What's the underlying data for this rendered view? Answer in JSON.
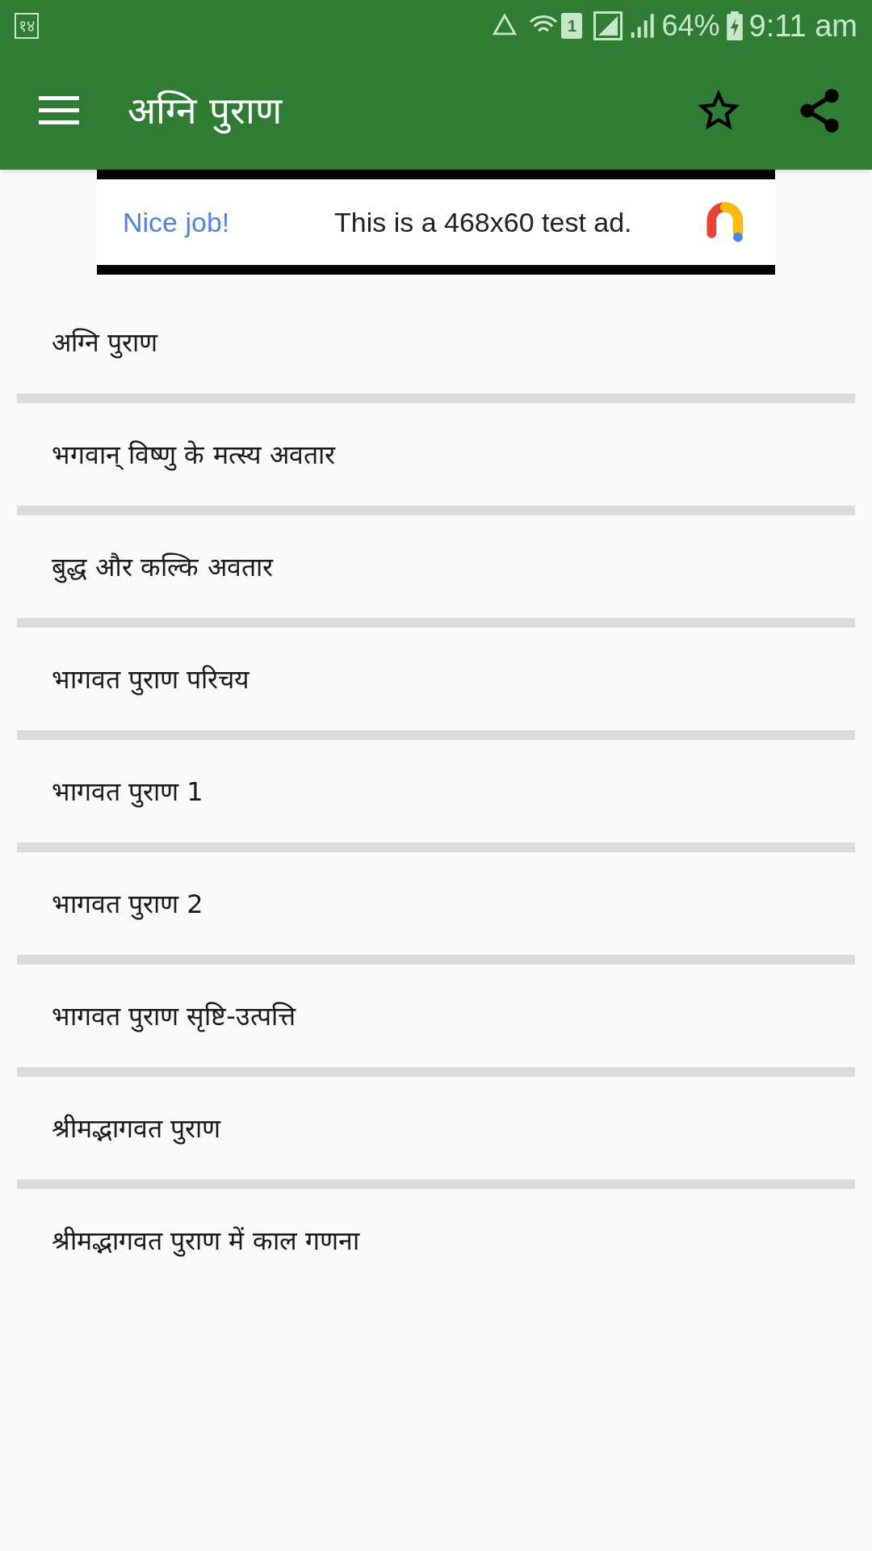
{
  "status_bar": {
    "notification": "१४",
    "battery": "64%",
    "time": "9:11 am",
    "sim": "1"
  },
  "toolbar": {
    "title": "अग्नि पुराण"
  },
  "ad": {
    "headline": "Nice job!",
    "text": "This is a 468x60 test ad."
  },
  "items": [
    {
      "label": "अग्नि पुराण"
    },
    {
      "label": "भगवान् विष्णु के मत्स्य अवतार"
    },
    {
      "label": "बुद्ध और कल्कि अवतार"
    },
    {
      "label": "भागवत पुराण परिचय"
    },
    {
      "label": "भागवत पुराण 1"
    },
    {
      "label": "भागवत पुराण 2"
    },
    {
      "label": "भागवत पुराण सृष्टि-उत्पत्ति"
    },
    {
      "label": "श्रीमद्भागवत पुराण"
    },
    {
      "label": "श्रीमद्भागवत पुराण में काल गणना"
    }
  ]
}
